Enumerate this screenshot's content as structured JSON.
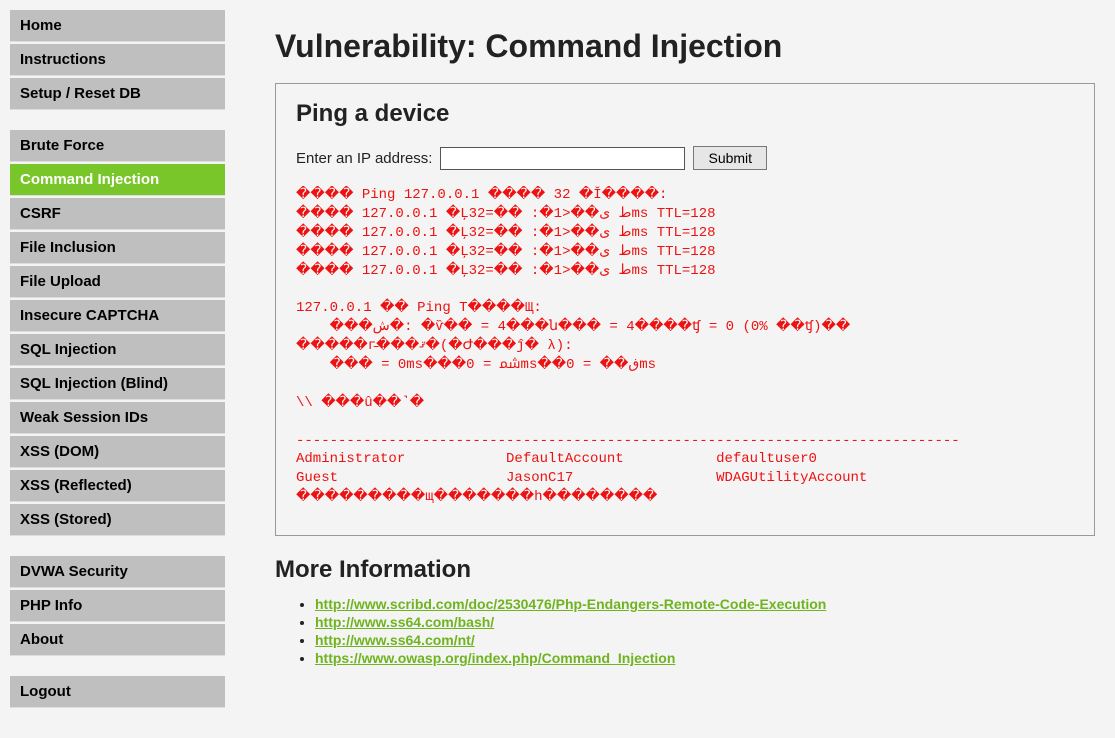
{
  "page_title": "Vulnerability: Command Injection",
  "nav": {
    "group1": [
      "Home",
      "Instructions",
      "Setup / Reset DB"
    ],
    "group2": [
      "Brute Force",
      "Command Injection",
      "CSRF",
      "File Inclusion",
      "File Upload",
      "Insecure CAPTCHA",
      "SQL Injection",
      "SQL Injection (Blind)",
      "Weak Session IDs",
      "XSS (DOM)",
      "XSS (Reflected)",
      "XSS (Stored)"
    ],
    "group3": [
      "DVWA Security",
      "PHP Info",
      "About"
    ],
    "group4": [
      "Logout"
    ],
    "active": "Command Injection"
  },
  "panel": {
    "heading": "Ping a device",
    "label": "Enter an IP address:",
    "input_value": "",
    "submit": "Submit",
    "output": "���� Ping 127.0.0.1 ���� 32 �Ǐ����:\n���� 127.0.0.1 �Ļ32=�� :�ط ﻯ��<1ms TTL=128\n���� 127.0.0.1 �Ļ32=�� :�ط ﻯ��<1ms TTL=128\n���� 127.0.0.1 �Ļ32=�� :�ط ﻯ��<1ms TTL=128\n���� 127.0.0.1 �Ļ32=�� :�ط ﻯ��<1ms TTL=128\n\n127.0.0.1 �� Ping T����Щ:\n    ���ش�: �ѷ�� = 4���ն��� = 4����ʧ = 0 (0% ��ʧ)��\n�����г̵���ޤ�(�Ժ���ĵ� λ):\n    ��� = 0ms���ﴰ = 0ms��ڧ�� = 0ms\n\n\\\\ ���û��˺�\n\n-------------------------------------------------------------------------------\nAdministrator            DefaultAccount           defaultuser0\nGuest                    JasonC17                 WDAGUtilityAccount\n���������щ�������h��������"
  },
  "more_info": {
    "heading": "More Information",
    "links": [
      "http://www.scribd.com/doc/2530476/Php-Endangers-Remote-Code-Execution",
      "http://www.ss64.com/bash/",
      "http://www.ss64.com/nt/",
      "https://www.owasp.org/index.php/Command_Injection"
    ]
  }
}
